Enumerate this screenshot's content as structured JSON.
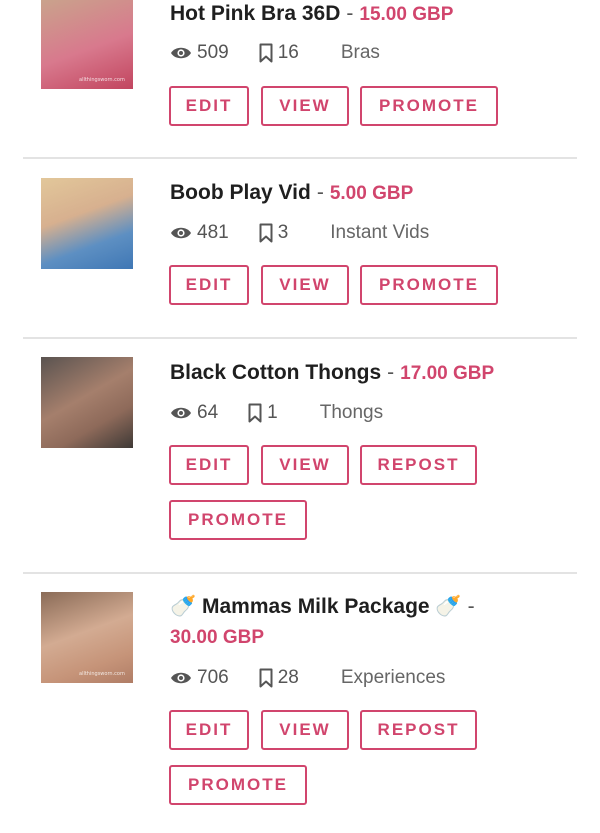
{
  "accent_color": "#d1456d",
  "listings": [
    {
      "title": "Hot Pink Bra 36D",
      "separator": "-",
      "price": "15.00 GBP",
      "views": "509",
      "saves": "16",
      "category": "Bras",
      "thumb_watermark": "allthingsworn.com",
      "buttons": [
        "EDIT",
        "VIEW",
        "PROMOTE"
      ]
    },
    {
      "title": "Boob Play Vid",
      "separator": "-",
      "price": "5.00 GBP",
      "views": "481",
      "saves": "3",
      "category": "Instant Vids",
      "buttons": [
        "EDIT",
        "VIEW",
        "PROMOTE"
      ]
    },
    {
      "title": "Black Cotton Thongs",
      "separator": "-",
      "price": "17.00 GBP",
      "views": "64",
      "saves": "1",
      "category": "Thongs",
      "buttons": [
        "EDIT",
        "VIEW",
        "REPOST",
        "PROMOTE"
      ]
    },
    {
      "title": "🍼 Mammas Milk Package 🍼",
      "separator": "-",
      "price": "30.00 GBP",
      "views": "706",
      "saves": "28",
      "category": "Experiences",
      "thumb_watermark": "allthingsworn.com",
      "buttons": [
        "EDIT",
        "VIEW",
        "REPOST",
        "PROMOTE"
      ]
    }
  ],
  "icons": {
    "views": "eye-icon",
    "saves": "bookmark-icon"
  }
}
